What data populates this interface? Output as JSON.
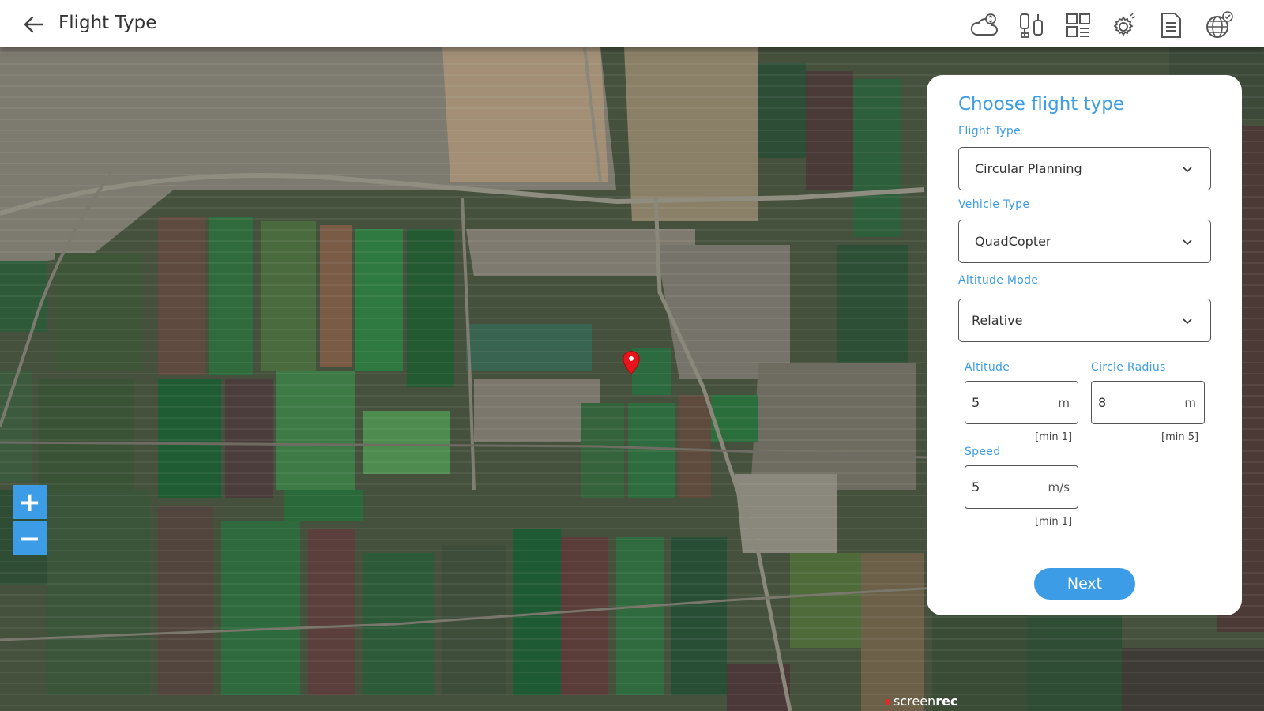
{
  "header": {
    "title": "Flight Type",
    "back_icon": "arrow-left-icon",
    "tools": [
      {
        "name": "cloud-sync-icon"
      },
      {
        "name": "drone-controls-icon"
      },
      {
        "name": "layout-icon"
      },
      {
        "name": "settings-gear-icon"
      },
      {
        "name": "document-icon"
      },
      {
        "name": "globe-check-icon"
      }
    ]
  },
  "map": {
    "zoom_in_label": "+",
    "zoom_out_label": "−",
    "marker_color": "#e8141b",
    "watermark_prefix": "screen",
    "watermark_suffix": "rec"
  },
  "panel": {
    "title": "Choose flight type",
    "flight_type": {
      "label": "Flight Type",
      "value": "Circular Planning"
    },
    "vehicle_type": {
      "label": "Vehicle Type",
      "value": "QuadCopter"
    },
    "altitude_mode": {
      "label": "Altitude Mode",
      "value": "Relative"
    },
    "altitude": {
      "label": "Altitude",
      "value": "5",
      "unit": "m",
      "hint": "[min 1]"
    },
    "circle_radius": {
      "label": "Circle Radius",
      "value": "8",
      "unit": "m",
      "hint": "[min 5]"
    },
    "speed": {
      "label": "Speed",
      "value": "5",
      "unit": "m/s",
      "hint": "[min 1]"
    },
    "next_label": "Next"
  },
  "colors": {
    "accent": "#3c9de6",
    "header_bg": "#ffffff",
    "panel_bg": "#ffffff"
  }
}
